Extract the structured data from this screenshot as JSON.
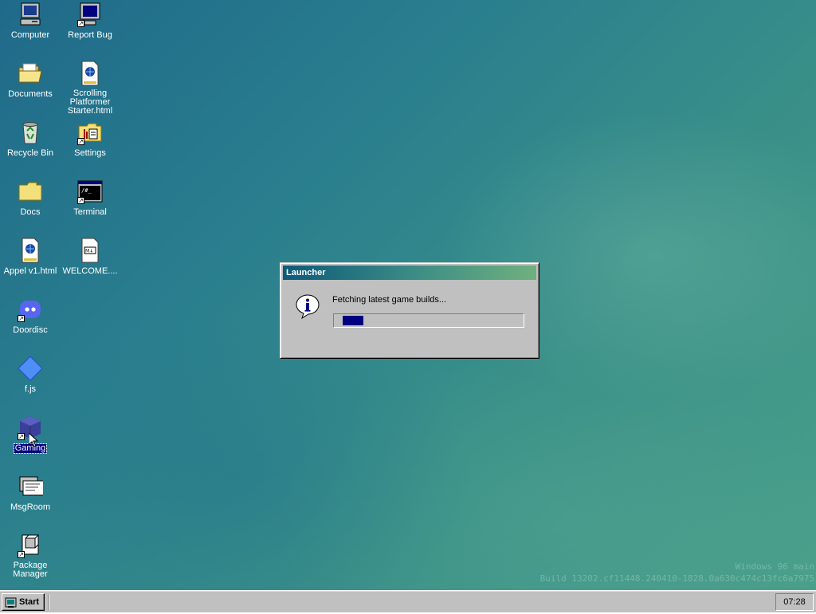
{
  "desktop": {
    "icons": [
      {
        "id": "computer",
        "label": "Computer",
        "icon": "computer-icon"
      },
      {
        "id": "report-bug",
        "label": "Report Bug",
        "icon": "monitor-shortcut-icon"
      },
      {
        "id": "documents",
        "label": "Documents",
        "icon": "open-folder-icon"
      },
      {
        "id": "scrolling-platformer",
        "label": "Scrolling Platformer Starter.html",
        "icon": "html-file-icon"
      },
      {
        "id": "recycle-bin",
        "label": "Recycle Bin",
        "icon": "recycle-bin-icon"
      },
      {
        "id": "settings",
        "label": "Settings",
        "icon": "settings-folder-icon"
      },
      {
        "id": "docs",
        "label": "Docs",
        "icon": "folder-icon"
      },
      {
        "id": "terminal",
        "label": "Terminal",
        "icon": "terminal-icon"
      },
      {
        "id": "appel",
        "label": "Appel v1.html",
        "icon": "html-file-icon"
      },
      {
        "id": "welcome",
        "label": "WELCOME....",
        "icon": "markdown-file-icon"
      },
      {
        "id": "doordisc",
        "label": "Doordisc",
        "icon": "discord-icon"
      },
      {
        "id": "fjs",
        "label": "f.js",
        "icon": "diamond-icon"
      },
      {
        "id": "gaming",
        "label": "Gaming",
        "icon": "cube-icon",
        "selected": true
      },
      {
        "id": "msgroom",
        "label": "MsgRoom",
        "icon": "chat-icon"
      },
      {
        "id": "package-manager",
        "label": "Package Manager",
        "icon": "package-icon"
      }
    ]
  },
  "dialog": {
    "title": "Launcher",
    "message": "Fetching latest game builds...",
    "progress": 0.11,
    "icon": "info-icon"
  },
  "watermark": {
    "line1": "Windows 96 main",
    "line2": "Build 13202.cf11448.240410-1828.0a630c474c13fc6a7975"
  },
  "taskbar": {
    "start_label": "Start",
    "clock": "07:28"
  },
  "colors": {
    "selection": "#000080",
    "progress_fill": "#000080",
    "taskbar": "#c0c0c0"
  }
}
